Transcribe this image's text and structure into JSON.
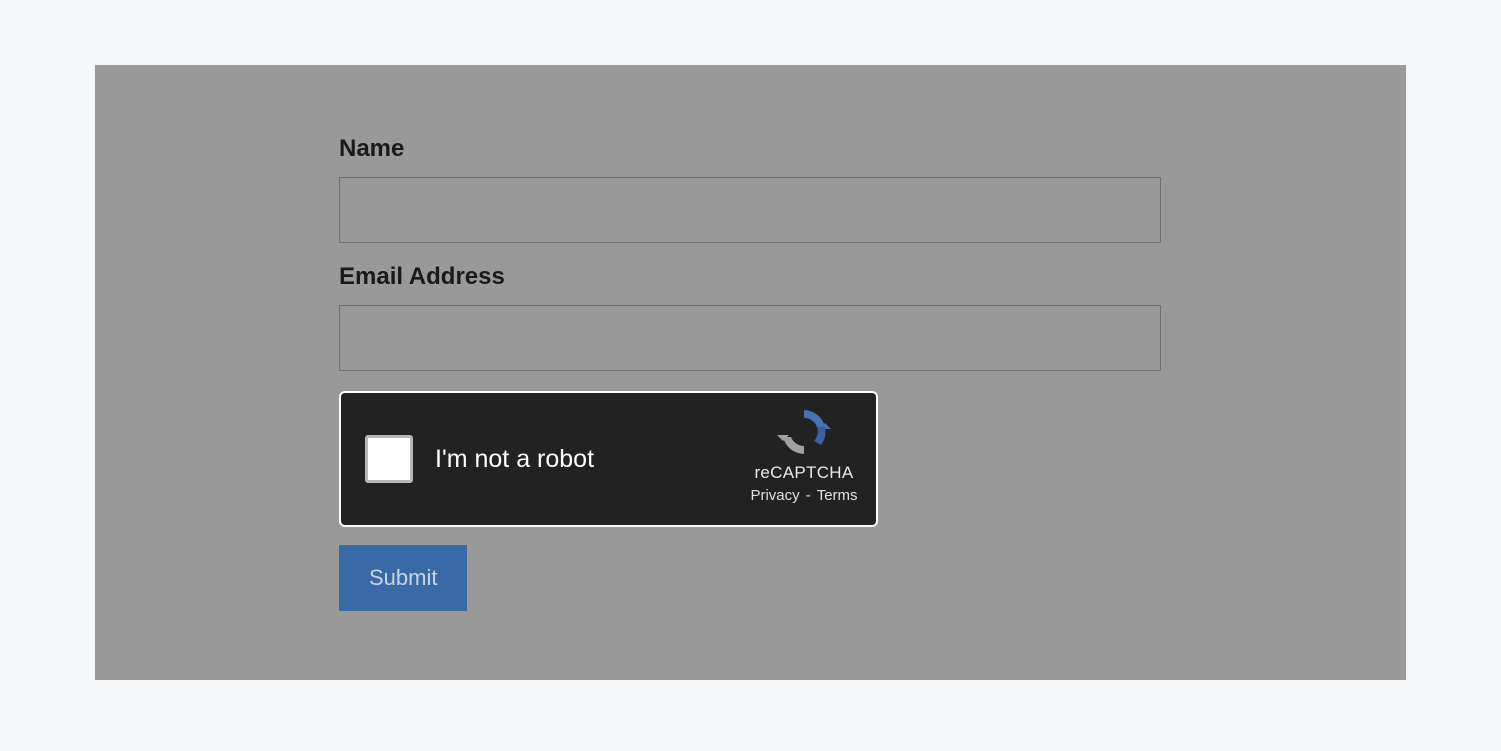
{
  "form": {
    "name_label": "Name",
    "name_value": "",
    "email_label": "Email Address",
    "email_value": "",
    "submit_label": "Submit"
  },
  "recaptcha": {
    "label": "I'm not a robot",
    "brand": "reCAPTCHA",
    "privacy_label": "Privacy",
    "terms_label": "Terms",
    "separator": "-"
  }
}
